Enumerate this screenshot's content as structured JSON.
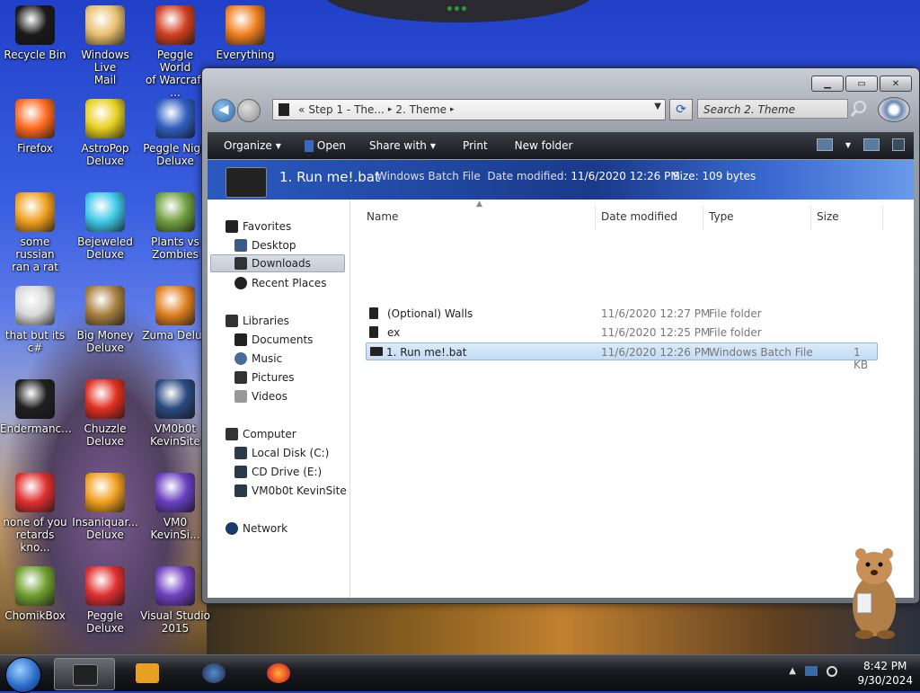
{
  "desktop": {
    "icons": [
      {
        "label": "Recycle Bin",
        "color": "#1a1a1a"
      },
      {
        "label": "Windows Live\nMail",
        "color": "#e8c070"
      },
      {
        "label": "Peggle World\nof Warcraft ...",
        "color": "#d04020"
      },
      {
        "label": "Everything",
        "color": "#f08020"
      },
      {
        "label": "Firefox",
        "color": "#ff6a20"
      },
      {
        "label": "AstroPop\nDeluxe",
        "color": "#e8d020"
      },
      {
        "label": "Peggle Nigh\nDeluxe",
        "color": "#3060c0"
      },
      {
        "label": "some russian\nran a rat",
        "color": "#f0a020"
      },
      {
        "label": "Bejeweled\nDeluxe",
        "color": "#40c8e8"
      },
      {
        "label": "Plants vs\nZombies",
        "color": "#70a040"
      },
      {
        "label": "that but its c#",
        "color": "#d8d8d8"
      },
      {
        "label": "Big Money\nDeluxe",
        "color": "#a88040"
      },
      {
        "label": "Zuma Delux",
        "color": "#e08020"
      },
      {
        "label": "Endermanc...",
        "color": "#202020"
      },
      {
        "label": "Chuzzle\nDeluxe",
        "color": "#e03020"
      },
      {
        "label": "VM0b0t\nKevinSite",
        "color": "#2a4a80"
      },
      {
        "label": "none of you\nretards kno...",
        "color": "#e03030"
      },
      {
        "label": "Insaniquar...\nDeluxe",
        "color": "#f0a020"
      },
      {
        "label": "VM0\nKevinSi...",
        "color": "#6a40c0"
      },
      {
        "label": "ChomikBox",
        "color": "#70a030"
      },
      {
        "label": "Peggle Deluxe",
        "color": "#e03030"
      },
      {
        "label": "Visual Studio\n2015",
        "color": "#7040c0"
      }
    ]
  },
  "window": {
    "controls": {
      "minimize": "▁",
      "maximize": "▭",
      "close": "✕"
    },
    "address": {
      "prefix": "«",
      "crumb1": "Step 1 - The...",
      "sep": "▸",
      "crumb2": "2. Theme",
      "sep2": "▸"
    },
    "search_placeholder": "Search 2. Theme",
    "commands": [
      {
        "label": "Organize",
        "dropdown": true
      },
      {
        "label": "Open",
        "dropdown": false
      },
      {
        "label": "Share with",
        "dropdown": true
      },
      {
        "label": "Print",
        "dropdown": false
      },
      {
        "label": "New folder",
        "dropdown": false
      }
    ],
    "details": {
      "name": "1. Run me!.bat",
      "type": "Windows Batch File",
      "modified_label": "Date modified:",
      "modified": "11/6/2020 12:26 PM",
      "size_label": "Size:",
      "size": "109 bytes"
    },
    "nav": {
      "favorites": "Favorites",
      "desktop": "Desktop",
      "downloads": "Downloads",
      "recent": "Recent Places",
      "libraries": "Libraries",
      "documents": "Documents",
      "music": "Music",
      "pictures": "Pictures",
      "videos": "Videos",
      "computer": "Computer",
      "local_disk": "Local Disk (C:)",
      "cd_drive": "CD Drive (E:)",
      "vm": "VM0b0t KevinSite",
      "network": "Network"
    },
    "columns": {
      "name": "Name",
      "date": "Date modified",
      "type": "Type",
      "size": "Size"
    },
    "files": [
      {
        "name": "(Optional) Walls",
        "date": "11/6/2020 12:27 PM",
        "type": "File folder",
        "size": ""
      },
      {
        "name": "ex",
        "date": "11/6/2020 12:25 PM",
        "type": "File folder",
        "size": ""
      },
      {
        "name": "1. Run me!.bat",
        "date": "11/6/2020 12:26 PM",
        "type": "Windows Batch File",
        "size": "1 KB"
      }
    ]
  },
  "taskbar": {
    "time": "8:42 PM",
    "date": "9/30/2024",
    "tray_arrow": "▲"
  }
}
